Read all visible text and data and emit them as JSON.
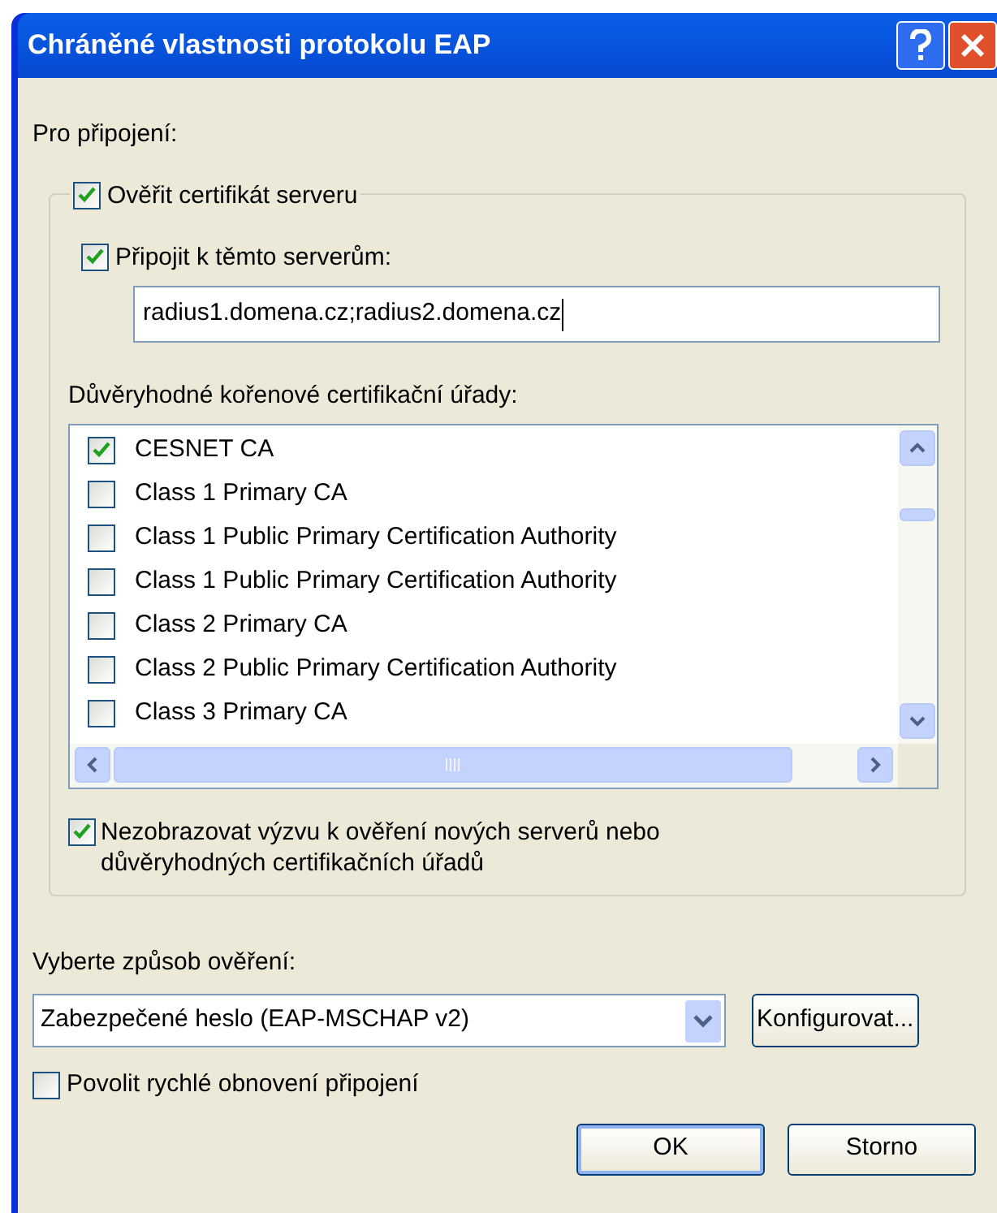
{
  "window": {
    "title": "Chráněné vlastnosti protokolu EAP"
  },
  "connect_label": "Pro připojení:",
  "validate_cert": {
    "label": "Ověřit certifikát serveru",
    "checked": true
  },
  "connect_servers": {
    "label": "Připojit k těmto serverům:",
    "checked": true
  },
  "servers_field": {
    "value": "radius1.domena.cz;radius2.domena.cz"
  },
  "trusted_label": "Důvěryhodné kořenové certifikační úřady:",
  "authorities": [
    {
      "label": "CESNET CA",
      "checked": true
    },
    {
      "label": "Class 1 Primary CA",
      "checked": false
    },
    {
      "label": "Class 1 Public Primary Certification Authority",
      "checked": false
    },
    {
      "label": "Class 1 Public Primary Certification Authority",
      "checked": false
    },
    {
      "label": "Class 2 Primary CA",
      "checked": false
    },
    {
      "label": "Class 2 Public Primary Certification Authority",
      "checked": false
    },
    {
      "label": "Class 3 Primary CA",
      "checked": false
    }
  ],
  "no_prompt": {
    "label": "Nezobrazovat výzvu k ověření nových serverů nebo důvěryhodných certifikačních úřadů",
    "checked": true
  },
  "method_label": "Vyberte způsob ověření:",
  "method_select": {
    "value": "Zabezpečené heslo (EAP-MSCHAP v2)"
  },
  "configure_button": "Konfigurovat...",
  "fast_reconnect": {
    "label": "Povolit rychlé obnovení připojení",
    "checked": false
  },
  "buttons": [
    "OK",
    "Storno"
  ]
}
